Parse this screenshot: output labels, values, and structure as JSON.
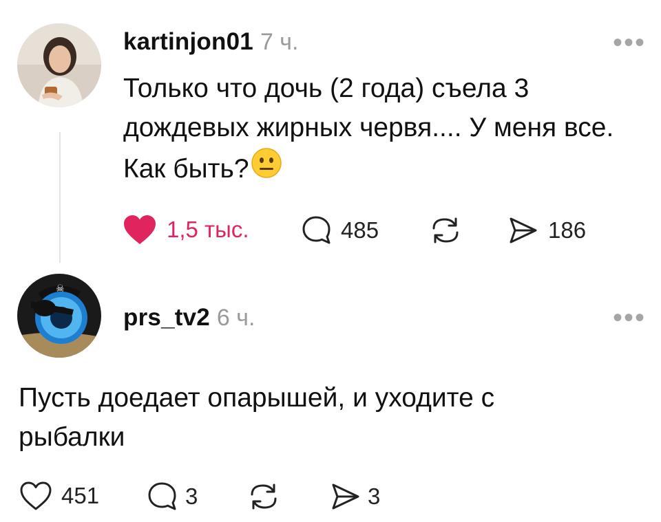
{
  "post": {
    "username": "kartinjon01",
    "time": "7 ч.",
    "text_line1": "Только что дочь (2 года) съела 3",
    "text_line2": "дождевых жирных червя.... У меня все.",
    "text_line3": "Как быть?",
    "emoji": "neutral-face-emoji",
    "likes": "1,5 тыс.",
    "comments": "485",
    "shares": "186",
    "liked": true,
    "like_color": "#e0245e"
  },
  "reply": {
    "username": "prs_tv2",
    "time": "6 ч.",
    "text_line1": "Пусть доедает опарышей, и уходите с",
    "text_line2": "рыбалки",
    "likes": "451",
    "comments": "3",
    "shares": "3"
  },
  "more_icon": "•••"
}
